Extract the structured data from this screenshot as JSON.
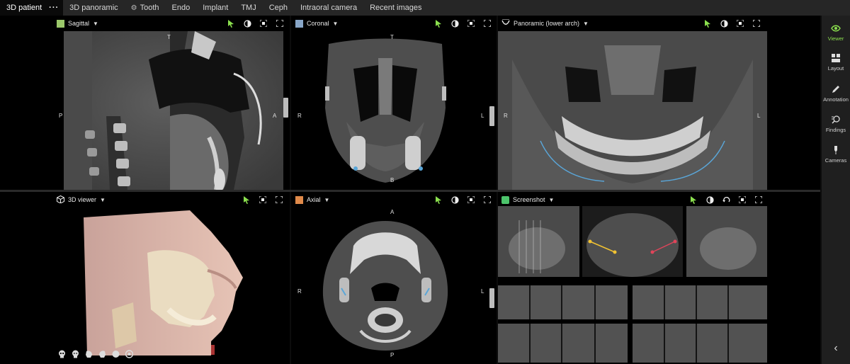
{
  "tabs": [
    {
      "label": "3D patient",
      "active": true
    },
    {
      "label": "3D panoramic"
    },
    {
      "label": "Tooth",
      "icon": "gear-icon"
    },
    {
      "label": "Endo"
    },
    {
      "label": "Implant"
    },
    {
      "label": "TMJ"
    },
    {
      "label": "Ceph"
    },
    {
      "label": "Intraoral camera"
    },
    {
      "label": "Recent images"
    }
  ],
  "tab_more": "···",
  "sidebar": {
    "items": [
      {
        "label": "Viewer",
        "icon": "eye-icon",
        "active": true
      },
      {
        "label": "Layout",
        "icon": "layout-icon"
      },
      {
        "label": "Annotation",
        "icon": "pencil-icon"
      },
      {
        "label": "Findings",
        "icon": "findings-icon"
      },
      {
        "label": "Cameras",
        "icon": "camera-marker-icon"
      }
    ],
    "collapse": "‹"
  },
  "panes": {
    "sagittal": {
      "title": "Sagittal",
      "swatch": "#9bc86a",
      "orient_top": "T",
      "orient_left": "P",
      "orient_right": "A"
    },
    "coronal": {
      "title": "Coronal",
      "swatch": "#88a6c8",
      "orient_top": "T",
      "orient_left": "R",
      "orient_right": "L",
      "orient_bottom": "B"
    },
    "panoramic": {
      "title": "Panoramic (lower arch)",
      "orient_left": "R",
      "orient_right": "L"
    },
    "viewer3d": {
      "title": "3D viewer"
    },
    "axial": {
      "title": "Axial",
      "swatch": "#e08a4a",
      "orient_top": "A",
      "orient_left": "R",
      "orient_right": "L",
      "orient_bottom": "P"
    },
    "screenshot": {
      "title": "Screenshot",
      "swatch": "#4cc46b"
    }
  },
  "colors": {
    "accent_green": "#8be04e",
    "nerve_blue": "#5aa6d8",
    "marker_yellow": "#f1c232",
    "marker_red": "#e0445a"
  }
}
